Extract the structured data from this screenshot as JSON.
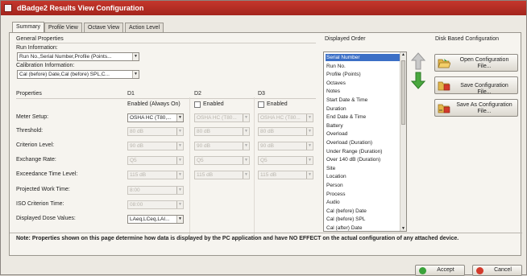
{
  "window": {
    "title": "dBadge2 Results View Configuration"
  },
  "tabs": [
    "Summary",
    "Profile View",
    "Octave View",
    "Action Level"
  ],
  "general": {
    "heading": "General Properties",
    "run_info_label": "Run Information:",
    "run_info_value": "Run No.,Serial Number,Profile (Points...",
    "calib_label": "Calibration Information:",
    "calib_value": "Cal (before) Date,Cal (before) SPL,C..."
  },
  "properties": {
    "heading": "Properties",
    "columns": [
      {
        "name": "D1",
        "status": "Enabled (Always On)",
        "checkbox": false
      },
      {
        "name": "D2",
        "status": "Enabled",
        "checkbox": true
      },
      {
        "name": "D3",
        "status": "Enabled",
        "checkbox": true
      }
    ],
    "rows": [
      {
        "label": "Meter Setup:",
        "values": [
          "OSHA HC (T80,...",
          "OSHA HC (T80...",
          "OSHA HC (T80..."
        ],
        "enabled": [
          true,
          false,
          false
        ]
      },
      {
        "label": "Threshold:",
        "values": [
          "80 dB",
          "80 dB",
          "80 dB"
        ],
        "enabled": [
          false,
          false,
          false
        ]
      },
      {
        "label": "Criterion Level:",
        "values": [
          "90 dB",
          "90 dB",
          "90 dB"
        ],
        "enabled": [
          false,
          false,
          false
        ]
      },
      {
        "label": "Exchange Rate:",
        "values": [
          "Q5",
          "Q5",
          "Q5"
        ],
        "enabled": [
          false,
          false,
          false
        ]
      },
      {
        "label": "Exceedance Time Level:",
        "values": [
          "115 dB",
          "115 dB",
          "115 dB"
        ],
        "enabled": [
          false,
          false,
          false
        ]
      },
      {
        "label": "Projected Work Time:",
        "values": [
          "8:00"
        ],
        "enabled": [
          false
        ]
      },
      {
        "label": "ISO Criterion Time:",
        "values": [
          "08:00"
        ],
        "enabled": [
          false
        ]
      },
      {
        "label": "Displayed Dose Values:",
        "values": [
          "LAeq,LCeq,LAI..."
        ],
        "enabled": [
          true
        ]
      }
    ]
  },
  "displayed_order": {
    "heading": "Displayed Order",
    "selected": "Serial Number",
    "items": [
      "Serial Number",
      "Run No.",
      "Profile (Points)",
      "Octaves",
      "Notes",
      "Start Date & Time",
      "Duration",
      "End Date & Time",
      "Battery",
      "Overload",
      "Overload (Duration)",
      "Under Range (Duration)",
      "Over 140 dB (Duration)",
      "Site",
      "Location",
      "Person",
      "Process",
      "Audio",
      "Cal (before) Date",
      "Cal (before) SPL",
      "Cal (after) Date"
    ]
  },
  "disk_config": {
    "heading": "Disk Based Configuration",
    "open_label": "Open Configuration File...",
    "save_label": "Save Configuration File...",
    "save_as_label": "Save As Configuration File..."
  },
  "note": "Note: Properties shown on this page determine how data is displayed by the PC application and have NO EFFECT on the actual configuration of any attached device.",
  "buttons": {
    "accept": "Accept",
    "cancel": "Cancel"
  },
  "colors": {
    "title_bar": "#b22e24",
    "selection": "#3b6fc6",
    "accept_icon": "#3aa23a",
    "cancel_icon": "#d23a2c"
  }
}
